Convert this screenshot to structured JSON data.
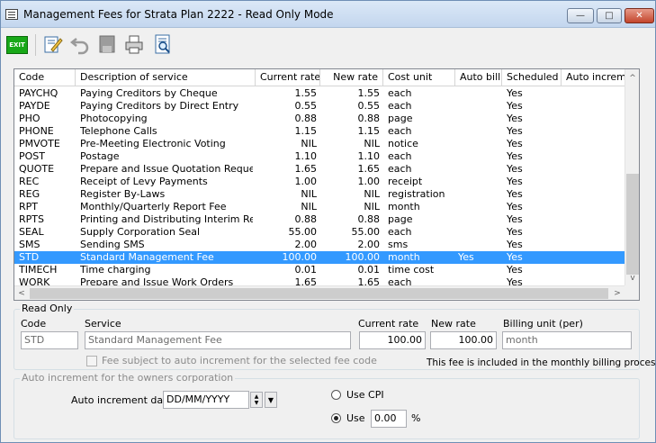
{
  "window": {
    "title": "Management Fees for Strata Plan 2222 - Read Only Mode",
    "minimize": "—",
    "maximize": "□",
    "close": "✕"
  },
  "toolbar": {
    "exit_label": "EXIT",
    "icons": [
      "exit-icon",
      "edit-icon",
      "undo-icon",
      "save-icon",
      "print-icon",
      "print-preview-icon"
    ]
  },
  "grid": {
    "columns": [
      "Code",
      "Description of service",
      "Current rate",
      "New rate",
      "Cost unit",
      "Auto bill",
      "Scheduled",
      "Auto increme"
    ],
    "rows": [
      {
        "code": "PAYCHQ",
        "desc": "Paying Creditors by Cheque",
        "current": "1.55",
        "new": "1.55",
        "unit": "each",
        "auto": "",
        "sched": "Yes",
        "selected": false
      },
      {
        "code": "PAYDE",
        "desc": "Paying Creditors by Direct Entry",
        "current": "0.55",
        "new": "0.55",
        "unit": "each",
        "auto": "",
        "sched": "Yes",
        "selected": false
      },
      {
        "code": "PHO",
        "desc": "Photocopying",
        "current": "0.88",
        "new": "0.88",
        "unit": "page",
        "auto": "",
        "sched": "Yes",
        "selected": false
      },
      {
        "code": "PHONE",
        "desc": "Telephone Calls",
        "current": "1.15",
        "new": "1.15",
        "unit": "each",
        "auto": "",
        "sched": "Yes",
        "selected": false
      },
      {
        "code": "PMVOTE",
        "desc": "Pre-Meeting Electronic Voting",
        "current": "NIL",
        "new": "NIL",
        "unit": "notice",
        "auto": "",
        "sched": "Yes",
        "selected": false
      },
      {
        "code": "POST",
        "desc": "Postage",
        "current": "1.10",
        "new": "1.10",
        "unit": "each",
        "auto": "",
        "sched": "Yes",
        "selected": false
      },
      {
        "code": "QUOTE",
        "desc": "Prepare and Issue Quotation Requests",
        "current": "1.65",
        "new": "1.65",
        "unit": "each",
        "auto": "",
        "sched": "Yes",
        "selected": false
      },
      {
        "code": "REC",
        "desc": "Receipt of Levy Payments",
        "current": "1.00",
        "new": "1.00",
        "unit": "receipt",
        "auto": "",
        "sched": "Yes",
        "selected": false
      },
      {
        "code": "REG",
        "desc": "Register By-Laws",
        "current": "NIL",
        "new": "NIL",
        "unit": "registration",
        "auto": "",
        "sched": "Yes",
        "selected": false
      },
      {
        "code": "RPT",
        "desc": "Monthly/Quarterly Report Fee",
        "current": "NIL",
        "new": "NIL",
        "unit": "month",
        "auto": "",
        "sched": "Yes",
        "selected": false
      },
      {
        "code": "RPTS",
        "desc": "Printing and Distributing Interim Reports",
        "current": "0.88",
        "new": "0.88",
        "unit": "page",
        "auto": "",
        "sched": "Yes",
        "selected": false
      },
      {
        "code": "SEAL",
        "desc": "Supply Corporation Seal",
        "current": "55.00",
        "new": "55.00",
        "unit": "each",
        "auto": "",
        "sched": "Yes",
        "selected": false
      },
      {
        "code": "SMS",
        "desc": "Sending SMS",
        "current": "2.00",
        "new": "2.00",
        "unit": "sms",
        "auto": "",
        "sched": "Yes",
        "selected": false
      },
      {
        "code": "STD",
        "desc": "Standard Management Fee",
        "current": "100.00",
        "new": "100.00",
        "unit": "month",
        "auto": "Yes",
        "sched": "Yes",
        "selected": true
      },
      {
        "code": "TIMECH",
        "desc": "Time charging",
        "current": "0.01",
        "new": "0.01",
        "unit": "time cost",
        "auto": "",
        "sched": "Yes",
        "selected": false
      },
      {
        "code": "WORK",
        "desc": "Prepare and Issue Work Orders",
        "current": "1.65",
        "new": "1.65",
        "unit": "each",
        "auto": "",
        "sched": "Yes",
        "selected": false
      }
    ],
    "scroll_up": "^",
    "scroll_down": "v",
    "scroll_left": "<",
    "scroll_right": ">"
  },
  "read_only": {
    "group_label": "Read Only",
    "code_label": "Code",
    "code_value": "STD",
    "service_label": "Service",
    "service_value": "Standard Management Fee",
    "current_rate_label": "Current rate",
    "current_rate_value": "100.00",
    "new_rate_label": "New rate",
    "new_rate_value": "100.00",
    "billing_unit_label": "Billing unit (per)",
    "billing_unit_value": "month",
    "auto_increment_checkbox": "Fee subject to auto increment for the selected fee code",
    "billing_note": "This fee is included in the monthly billing process."
  },
  "auto_increment": {
    "group_label": "Auto increment for the owners corporation",
    "date_label": "Auto increment date",
    "date_value": "DD/MM/YYYY",
    "use_cpi_label": "Use CPI",
    "use_label": "Use",
    "use_value": "0.00",
    "percent_label": "%",
    "selected_option": "use"
  }
}
